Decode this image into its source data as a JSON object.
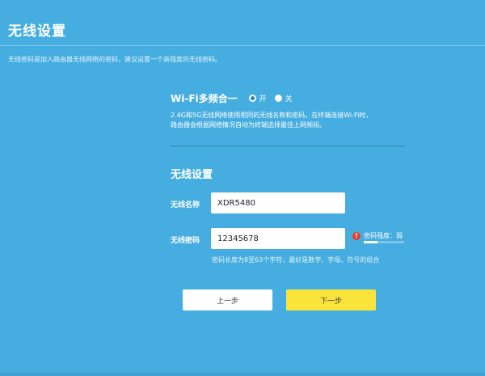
{
  "header": {
    "title": "无线设置",
    "subtitle": "无线密码是加入路由器无线网络的密码，建议设置一个高强度的无线密码。"
  },
  "wifi_merge": {
    "label": "Wi-Fi多频合一",
    "options": [
      {
        "label": "开",
        "checked": true
      },
      {
        "label": "关",
        "checked": false
      }
    ],
    "description_line1": "2.4G和5G无线网络使用相同的无线名称和密码，在终端连接Wi-Fi时，",
    "description_line2": "路由器会根据网络情况自动为终端选择最佳上网频段。"
  },
  "wireless": {
    "section_title": "无线设置",
    "ssid_label": "无线名称",
    "ssid_value": "XDR5480",
    "password_label": "无线密码",
    "password_value": "12345678",
    "strength_text": "密码强度：弱",
    "strength_level": 0.33,
    "hint": "密码长度为8至63个字符，最好是数字、字母、符号的组合"
  },
  "buttons": {
    "prev": "上一步",
    "next": "下一步"
  },
  "colors": {
    "background": "#45ade0",
    "next_button": "#fbe43a",
    "warning": "#e53f2e"
  }
}
